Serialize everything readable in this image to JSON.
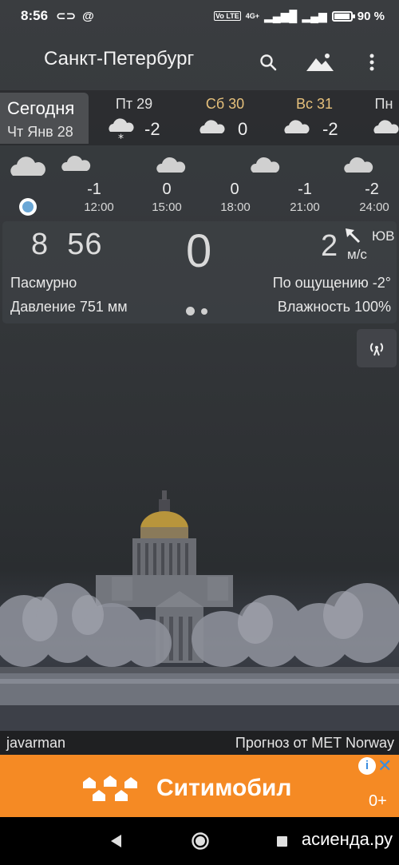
{
  "status_bar": {
    "time": "8:56",
    "network": "4G+",
    "volte": "Vo LTE",
    "battery": "90 %"
  },
  "app_bar": {
    "city": "Санкт-Петербург",
    "icons": [
      "search-icon",
      "landscape-icon",
      "more-vert-icon"
    ]
  },
  "days": {
    "today": {
      "label": "Сегодня",
      "date": "Чт Янв 28"
    },
    "items": [
      {
        "name": "Пт 29",
        "temp": "-2",
        "icon": "cloud-snow-icon"
      },
      {
        "name": "Сб 30",
        "temp": "0",
        "icon": "cloud-icon"
      },
      {
        "name": "Вс 31",
        "temp": "-2",
        "icon": "cloud-icon"
      },
      {
        "name": "Пн",
        "temp": "",
        "icon": "cloud-icon"
      }
    ],
    "weekend_color": "#e6c07b"
  },
  "hourly": [
    {
      "temp": "-1",
      "time": "12:00"
    },
    {
      "temp": "0",
      "time": "15:00"
    },
    {
      "temp": "0",
      "time": "18:00"
    },
    {
      "temp": "-1",
      "time": "21:00"
    },
    {
      "temp": "-2",
      "time": "24:00"
    }
  ],
  "current": {
    "clock": "8  56",
    "temp": "0",
    "wind_speed": "2",
    "wind_dir": "ЮВ",
    "wind_unit": "м/с",
    "condition": "Пасмурно",
    "feels_like": "По ощущению -2°",
    "pressure": "Давление 751 мм",
    "humidity": "Влажность 100%",
    "page_count": 2,
    "current_page": 1
  },
  "credits": {
    "photo_author": "javarman",
    "forecast_source": "Прогноз от MET Norway"
  },
  "ad": {
    "brand": "Ситимобил",
    "age_rating": "0+",
    "background": "#f58a24"
  },
  "navbar": {
    "watermark": "асиенда.ру"
  }
}
